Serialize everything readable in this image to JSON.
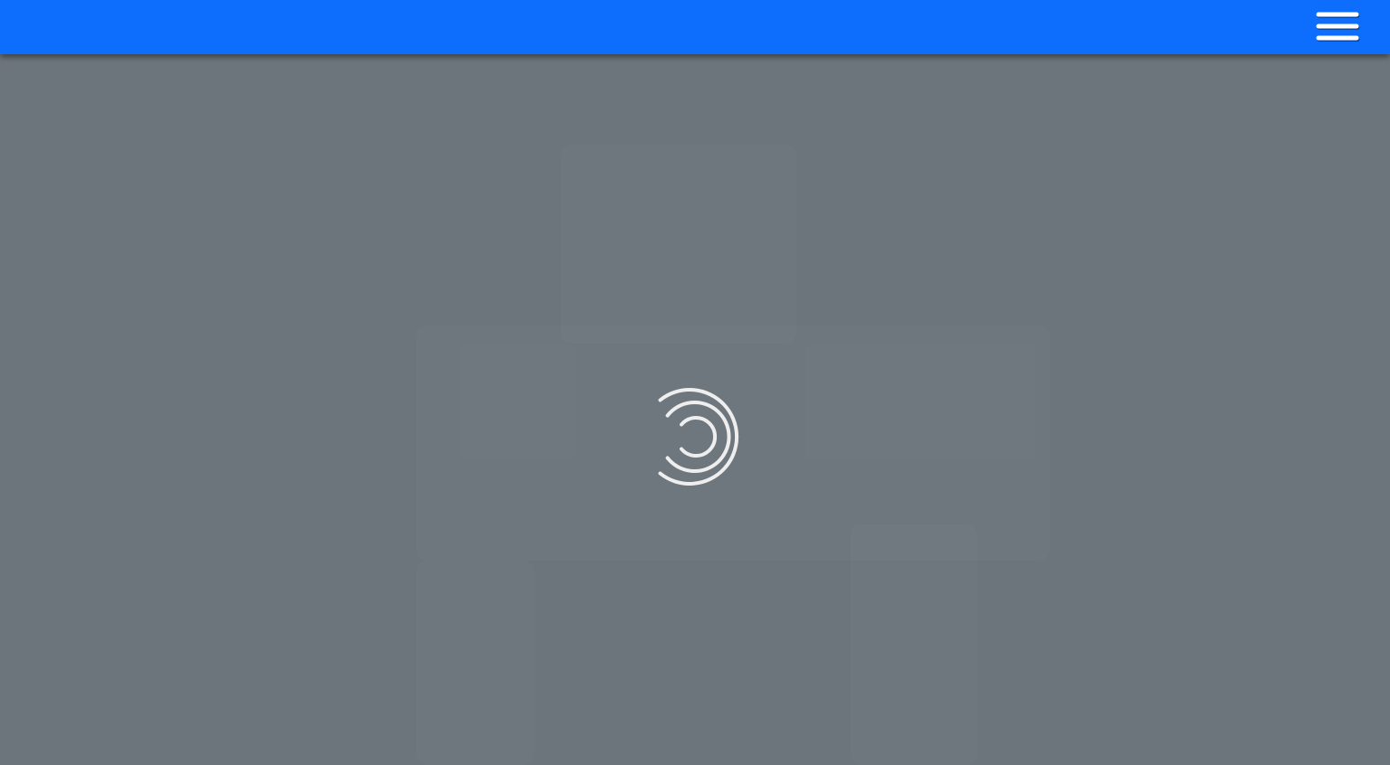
{
  "header": {
    "menu_icon": "hamburger-menu-icon",
    "background_color": "#0d6efd"
  },
  "main": {
    "background_color": "#6c747c",
    "loading_icon": "loading-spinner-icon"
  }
}
